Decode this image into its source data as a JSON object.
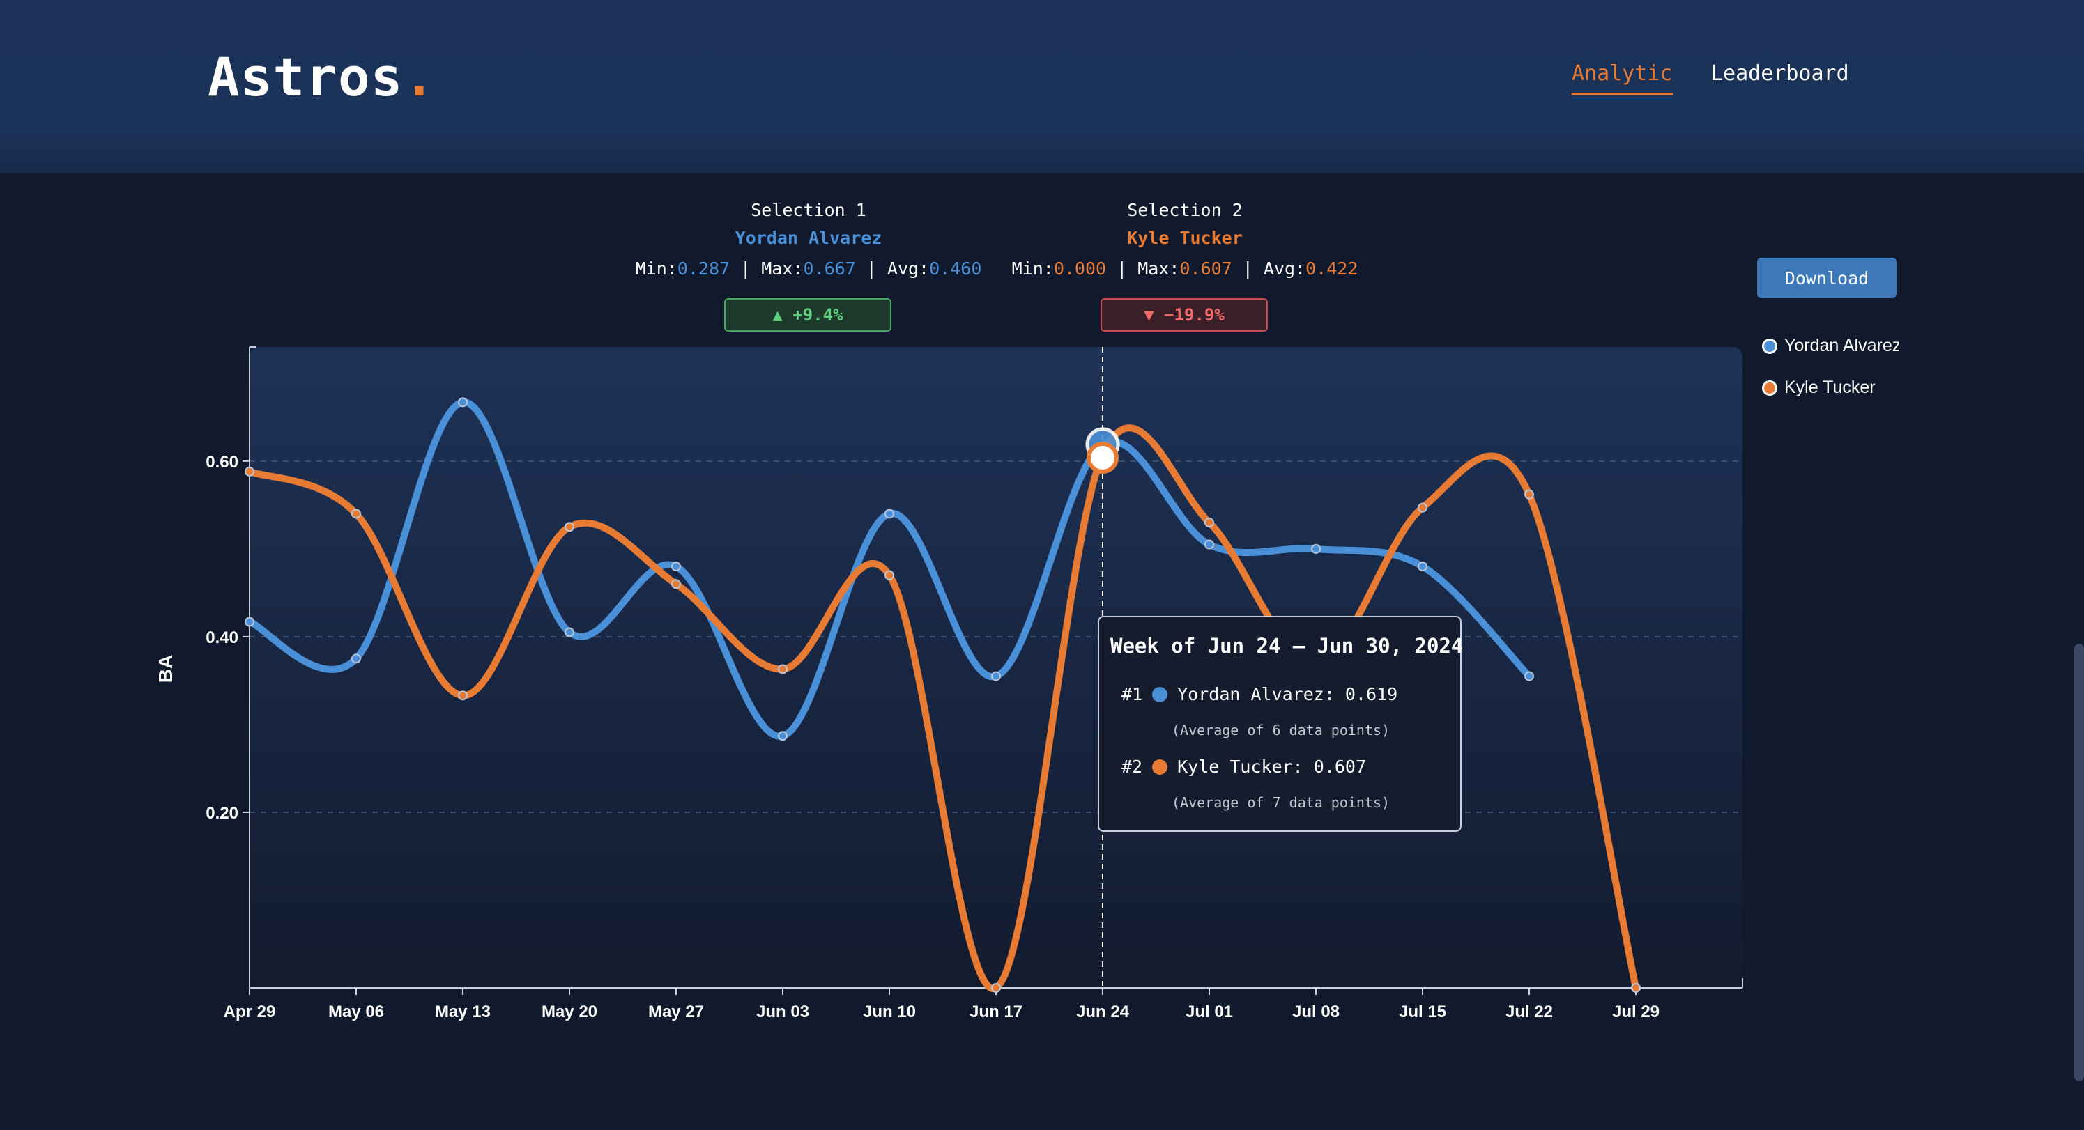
{
  "header": {
    "logo_text": "Astros",
    "logo_dot": ".",
    "nav": [
      {
        "label": "Analytic",
        "active": true
      },
      {
        "label": "Leaderboard",
        "active": false
      }
    ]
  },
  "selections": [
    {
      "title": "Selection 1",
      "player": "Yordan Alvarez",
      "min_label": "Min:",
      "min": "0.287",
      "max_label": "Max:",
      "max": "0.667",
      "avg_label": "Avg:",
      "avg": "0.460",
      "change": "▲ +9.4%",
      "color": "#4a90d9"
    },
    {
      "title": "Selection 2",
      "player": "Kyle Tucker",
      "min_label": "Min:",
      "min": "0.000",
      "max_label": "Max:",
      "max": "0.607",
      "avg_label": "Avg:",
      "avg": "0.422",
      "change": "▼ −19.9%",
      "color": "#e87b34"
    }
  ],
  "download_label": "Download",
  "legend": [
    {
      "label": "Yordan Alvarez",
      "color": "#4a90d9"
    },
    {
      "label": "Kyle Tucker",
      "color": "#e87b34"
    }
  ],
  "tooltip": {
    "title": "Week of Jun 24 – Jun 30, 2024",
    "rows": [
      {
        "rank": "#1",
        "text": "Yordan Alvarez: 0.619",
        "note": "(Average of 6 data points)",
        "color": "#4a90d9"
      },
      {
        "rank": "#2",
        "text": "Kyle Tucker: 0.607",
        "note": "(Average of 7 data points)",
        "color": "#e87b34"
      }
    ]
  },
  "chart_data": {
    "type": "line",
    "ylabel": "BA",
    "xlabel": "",
    "ylim": [
      0,
      0.73
    ],
    "yticks": [
      "0.20",
      "0.40",
      "0.60"
    ],
    "ytick_values": [
      0.2,
      0.4,
      0.6
    ],
    "categories": [
      "Apr 29",
      "May 06",
      "May 13",
      "May 20",
      "May 27",
      "Jun 03",
      "Jun 10",
      "Jun 17",
      "Jun 24",
      "Jul 01",
      "Jul 08",
      "Jul 15",
      "Jul 22",
      "Jul 29"
    ],
    "highlight_index": 8,
    "grid": "horizontal-dashed",
    "series": [
      {
        "name": "Yordan Alvarez",
        "color": "#4a90d9",
        "values": [
          0.417,
          0.375,
          0.667,
          0.405,
          0.48,
          0.287,
          0.54,
          0.355,
          0.619,
          0.505,
          0.5,
          0.48,
          0.355,
          null
        ]
      },
      {
        "name": "Kyle Tucker",
        "color": "#e87b34",
        "values": [
          0.588,
          0.54,
          0.333,
          0.525,
          0.46,
          0.363,
          0.47,
          0.0,
          0.607,
          0.53,
          0.37,
          0.547,
          0.562,
          0.0
        ]
      }
    ]
  },
  "scrollbar": "vertical-scrollbar"
}
